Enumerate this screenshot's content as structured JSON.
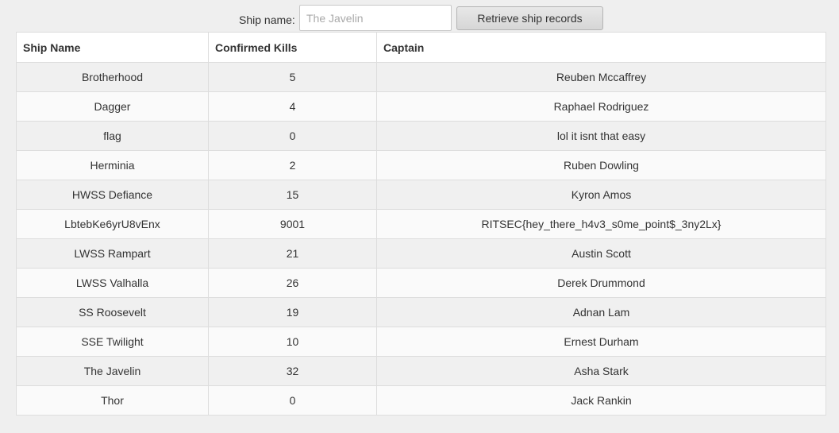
{
  "search": {
    "label": "Ship name:",
    "placeholder": "The Javelin",
    "value": "",
    "button_label": "Retrieve ship records"
  },
  "table": {
    "headers": [
      "Ship Name",
      "Confirmed Kills",
      "Captain"
    ],
    "rows": [
      {
        "ship": "Brotherhood",
        "kills": "5",
        "captain": "Reuben Mccaffrey"
      },
      {
        "ship": "Dagger",
        "kills": "4",
        "captain": "Raphael Rodriguez"
      },
      {
        "ship": "flag",
        "kills": "0",
        "captain": "lol it isnt that easy"
      },
      {
        "ship": "Herminia",
        "kills": "2",
        "captain": "Ruben Dowling"
      },
      {
        "ship": "HWSS Defiance",
        "kills": "15",
        "captain": "Kyron Amos"
      },
      {
        "ship": "LbtebKe6yrU8vEnx",
        "kills": "9001",
        "captain": "RITSEC{hey_there_h4v3_s0me_point$_3ny2Lx}"
      },
      {
        "ship": "LWSS Rampart",
        "kills": "21",
        "captain": "Austin Scott"
      },
      {
        "ship": "LWSS Valhalla",
        "kills": "26",
        "captain": "Derek Drummond"
      },
      {
        "ship": "SS Roosevelt",
        "kills": "19",
        "captain": "Adnan Lam"
      },
      {
        "ship": "SSE Twilight",
        "kills": "10",
        "captain": "Ernest Durham"
      },
      {
        "ship": "The Javelin",
        "kills": "32",
        "captain": "Asha Stark"
      },
      {
        "ship": "Thor",
        "kills": "0",
        "captain": "Jack Rankin"
      }
    ]
  }
}
